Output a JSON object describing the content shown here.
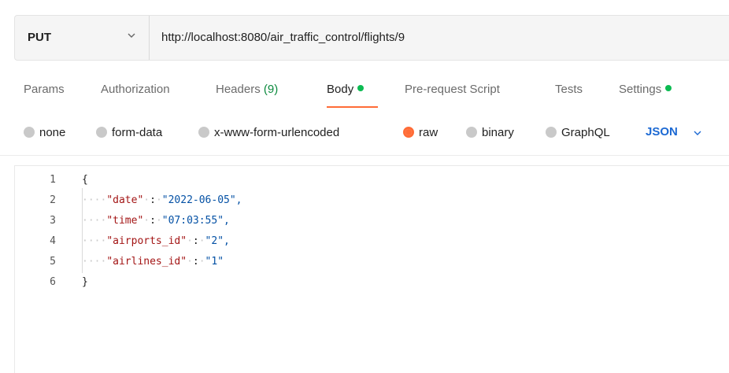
{
  "request": {
    "method": "PUT",
    "url": "http://localhost:8080/air_traffic_control/flights/9"
  },
  "tabs": [
    {
      "label": "Params"
    },
    {
      "label": "Authorization"
    },
    {
      "label": "Headers",
      "count": "(9)"
    },
    {
      "label": "Body"
    },
    {
      "label": "Pre-request Script"
    },
    {
      "label": "Tests"
    },
    {
      "label": "Settings"
    }
  ],
  "body_types": {
    "options": [
      "none",
      "form-data",
      "x-www-form-urlencoded",
      "raw",
      "binary",
      "GraphQL"
    ],
    "selected": "raw",
    "language": "JSON"
  },
  "editor": {
    "line_numbers": [
      "1",
      "2",
      "3",
      "4",
      "5",
      "6"
    ],
    "open_brace": "{",
    "close_brace": "}",
    "fields": [
      {
        "key": "\"date\"",
        "value": "\"2022-06-05\","
      },
      {
        "key": "\"time\"",
        "value": "\"07:03:55\","
      },
      {
        "key": "\"airports_id\"",
        "value": "\"2\","
      },
      {
        "key": "\"airlines_id\"",
        "value": "\"1\""
      }
    ]
  },
  "colors": {
    "accent": "#ff6c37",
    "status_green": "#0cbb52",
    "link_blue": "#1c69d3"
  },
  "icons": [
    "chevron-down-icon",
    "status-dot-icon",
    "radio-icon"
  ]
}
